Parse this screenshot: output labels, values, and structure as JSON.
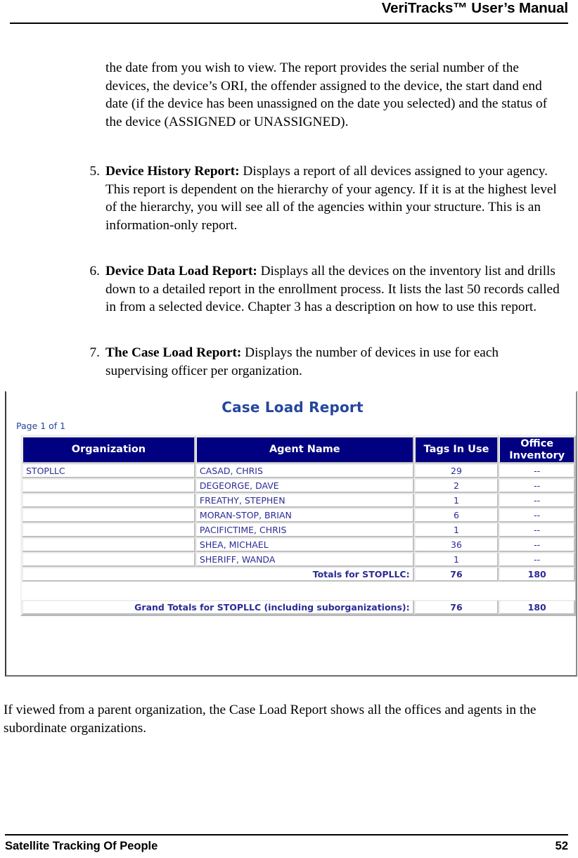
{
  "header": {
    "title": "VeriTracks™ User’s Manual"
  },
  "body": {
    "intro_paragraph": "the date from you wish to view.  The report provides the serial number of the devices, the device’s ORI, the offender assigned to the device, the start dand end date (if the device has been unassigned on the date you selected) and the status of the device (ASSIGNED or UNASSIGNED).",
    "list_items": [
      {
        "number": "5.",
        "title": "Device History Report:",
        "text": "  Displays a report of all devices assigned to your agency.  This report is dependent on the hierarchy of your agency.  If it is at the highest level of the hierarchy, you will see all of the agencies within your structure.  This is an information-only report."
      },
      {
        "number": "6.",
        "title": "Device Data Load Report:",
        "text": "  Displays all the devices on the inventory list and drills down to a detailed report in the enrollment process. It lists the last 50 records called in from a selected device. Chapter 3 has a description on how to use this report."
      },
      {
        "number": "7.",
        "title": "The Case Load Report:",
        "text": " Displays the number of devices in use for each supervising officer per organization."
      }
    ],
    "closing_paragraph": "If viewed from a parent organization, the Case Load Report shows all the offices and agents in the subordinate organizations."
  },
  "report": {
    "title": "Case Load Report",
    "page_label": "Page 1 of 1",
    "columns": [
      "Organization",
      "Agent Name",
      "Tags In Use",
      "Office Inventory"
    ],
    "column_inventory_line1": "Office",
    "column_inventory_line2": "Inventory",
    "rows": [
      {
        "organization": "STOPLLC",
        "agent": "CASAD, CHRIS",
        "tags": "29",
        "inventory": "--"
      },
      {
        "organization": "",
        "agent": "DEGEORGE, DAVE",
        "tags": "2",
        "inventory": "--"
      },
      {
        "organization": "",
        "agent": "FREATHY, STEPHEN",
        "tags": "1",
        "inventory": "--"
      },
      {
        "organization": "",
        "agent": "MORAN-STOP, BRIAN",
        "tags": "6",
        "inventory": "--"
      },
      {
        "organization": "",
        "agent": "PACIFICTIME, CHRIS",
        "tags": "1",
        "inventory": "--"
      },
      {
        "organization": "",
        "agent": "SHEA, MICHAEL",
        "tags": "36",
        "inventory": "--"
      },
      {
        "organization": "",
        "agent": "SHERIFF, WANDA",
        "tags": "1",
        "inventory": "--"
      }
    ],
    "totals": {
      "label": "Totals for STOPLLC:",
      "tags": "76",
      "inventory": "180"
    },
    "grand_totals": {
      "label": "Grand Totals for STOPLLC (including suborganizations):",
      "tags": "76",
      "inventory": "180"
    },
    "colors": {
      "header_background": "#000080",
      "header_text": "#ffffff",
      "title_text": "#24469c",
      "cell_text": "#2b2b96"
    }
  },
  "footer": {
    "left": "Satellite Tracking Of People",
    "page_number": "52"
  }
}
